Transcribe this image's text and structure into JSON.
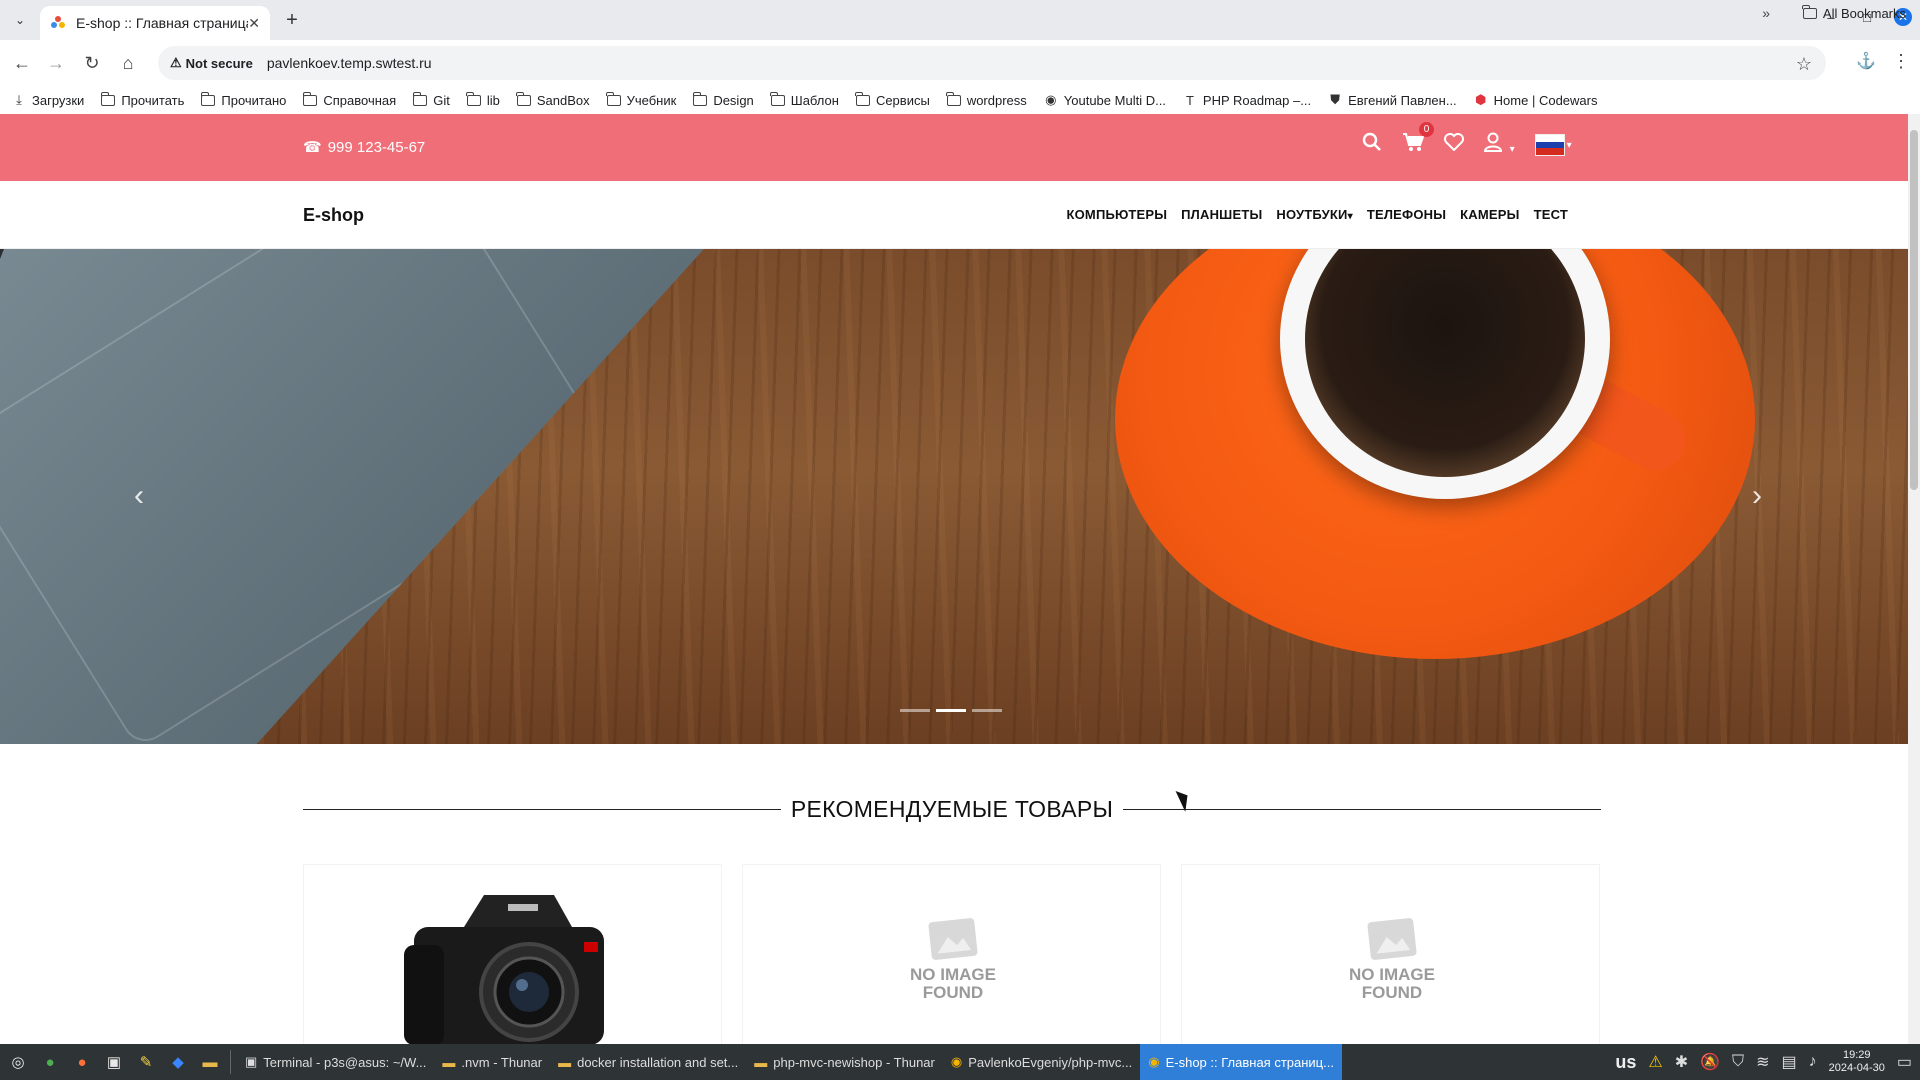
{
  "browser": {
    "tab_title": "E-shop :: Главная страница",
    "tab_close": "✕",
    "new_tab": "+",
    "security_label": "Not secure",
    "url": "pavlenkoev.temp.swtest.ru",
    "bookmarks": [
      {
        "label": "Загрузки",
        "icon": "download-icon"
      },
      {
        "label": "Прочитать",
        "icon": "folder-icon"
      },
      {
        "label": "Прочитано",
        "icon": "folder-icon"
      },
      {
        "label": "Справочная",
        "icon": "folder-icon"
      },
      {
        "label": "Git",
        "icon": "folder-icon"
      },
      {
        "label": "lib",
        "icon": "folder-icon"
      },
      {
        "label": "SandBox",
        "icon": "folder-icon"
      },
      {
        "label": "Учебник",
        "icon": "folder-icon"
      },
      {
        "label": "Design",
        "icon": "folder-icon"
      },
      {
        "label": "Шаблон",
        "icon": "folder-icon"
      },
      {
        "label": "Сервисы",
        "icon": "folder-icon"
      },
      {
        "label": "wordpress",
        "icon": "folder-icon"
      },
      {
        "label": "Youtube Multi D...",
        "icon": "globe-icon"
      },
      {
        "label": "PHP Roadmap –...",
        "icon": "site-icon"
      },
      {
        "label": "Евгений Павлен...",
        "icon": "shield-icon"
      },
      {
        "label": "Home | Codewars",
        "icon": "codewars-icon"
      }
    ],
    "all_bookmarks": "All Bookmarks"
  },
  "site": {
    "phone": "999 123-45-67",
    "cart_count": "0",
    "brand": "E-shop",
    "menu": [
      "КОМПЬЮТЕРЫ",
      "ПЛАНШЕТЫ",
      "НОУТБУКИ",
      "ТЕЛЕФОНЫ",
      "КАМЕРЫ",
      "ТЕСТ"
    ],
    "menu_dropdown_index": 2,
    "slider": {
      "slides": 3,
      "active": 1
    },
    "section_title": "РЕКОМЕНДУЕМЫЕ ТОВАРЫ",
    "products": [
      {
        "image": "camera"
      },
      {
        "image": "none",
        "placeholder_line1": "NO IMAGE",
        "placeholder_line2": "FOUND"
      },
      {
        "image": "none",
        "placeholder_line1": "NO IMAGE",
        "placeholder_line2": "FOUND"
      }
    ],
    "colors": {
      "topbar": "#f06e77",
      "badge": "#e0343f"
    }
  },
  "taskbar": {
    "tasks": [
      {
        "label": "Terminal - p3s@asus: ~/W...",
        "icon": "terminal-icon",
        "active": false
      },
      {
        "label": ".nvm - Thunar",
        "icon": "folder-icon",
        "active": false
      },
      {
        "label": "docker installation and set...",
        "icon": "folder-icon",
        "active": false
      },
      {
        "label": "php-mvc-newishop - Thunar",
        "icon": "folder-icon",
        "active": false
      },
      {
        "label": "PavlenkoEvgeniy/php-mvc...",
        "icon": "chrome-icon",
        "active": false
      },
      {
        "label": "E-shop :: Главная страниц...",
        "icon": "chrome-icon",
        "active": true
      }
    ],
    "keyboard_layout": "us",
    "time": "19:29",
    "date": "2024-04-30"
  }
}
